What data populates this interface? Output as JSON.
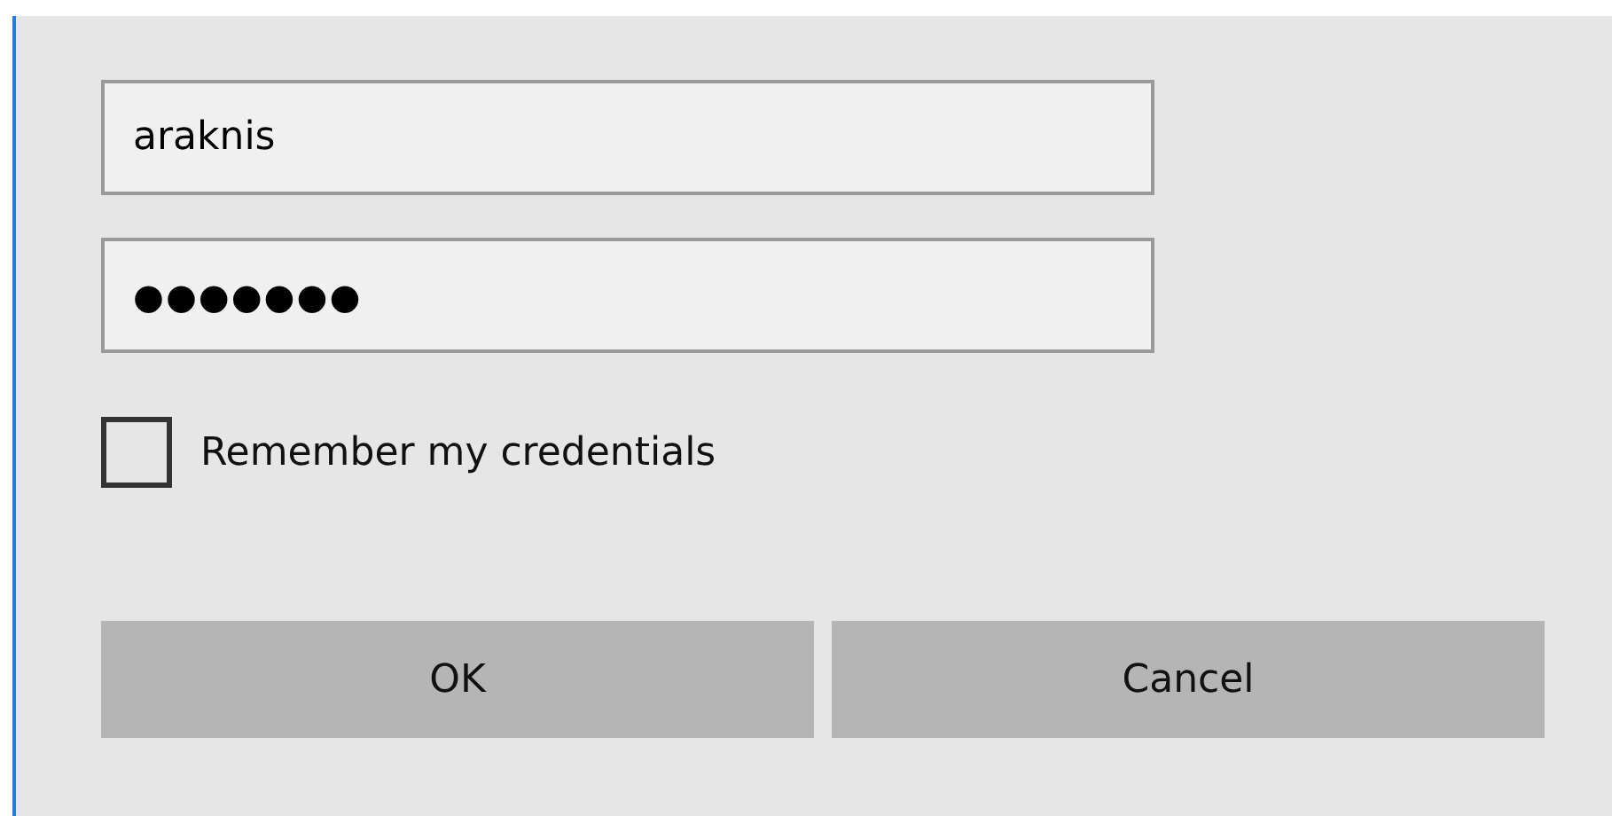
{
  "username": {
    "value": "araknis"
  },
  "password": {
    "value": "●●●●●●●"
  },
  "remember": {
    "label": "Remember my credentials",
    "checked": false
  },
  "buttons": [
    {
      "label": "OK"
    },
    {
      "label": "Cancel"
    }
  ]
}
